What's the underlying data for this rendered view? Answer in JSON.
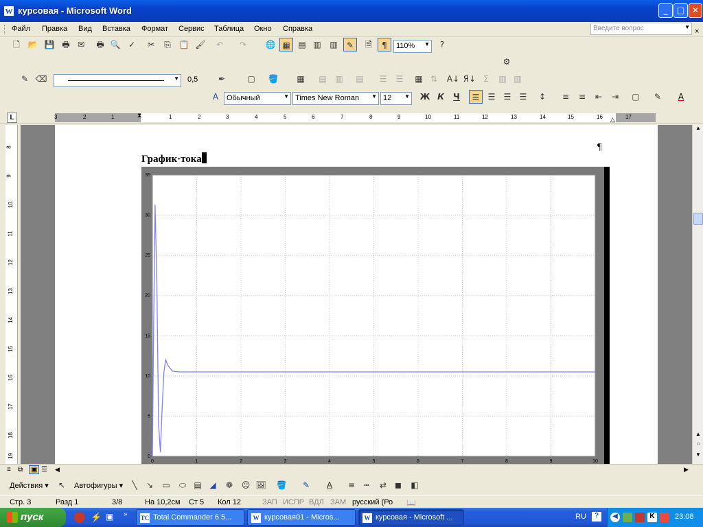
{
  "window": {
    "title": "курсовая - Microsoft Word",
    "app_icon": "word-icon"
  },
  "menu": {
    "items": [
      "Файл",
      "Правка",
      "Вид",
      "Вставка",
      "Формат",
      "Сервис",
      "Таблица",
      "Окно",
      "Справка"
    ],
    "ask_placeholder": "Введите вопрос"
  },
  "standard_toolbar": {
    "zoom": "110%"
  },
  "drawing_toolbar_top": {
    "line_width": "0,5"
  },
  "formatting_toolbar": {
    "style": "Обычный",
    "font": "Times New Roman",
    "size": "12"
  },
  "ruler": {
    "h_labels": [
      "3",
      "2",
      "1",
      "1",
      "2",
      "3",
      "4",
      "5",
      "6",
      "7",
      "8",
      "9",
      "10",
      "11",
      "12",
      "13",
      "14",
      "15",
      "16",
      "17"
    ],
    "v_labels": [
      "8",
      "9",
      "10",
      "11",
      "12",
      "13",
      "14",
      "15",
      "16",
      "17",
      "18",
      "19"
    ],
    "tab_button": "L"
  },
  "document": {
    "heading": "График·тока",
    "pilcrow": "¶"
  },
  "chart_data": {
    "type": "line",
    "title": "",
    "xlabel": "",
    "ylabel": "",
    "xlim": [
      0,
      10
    ],
    "ylim": [
      0,
      35
    ],
    "x_ticks": [
      "0",
      "1",
      "2",
      "3",
      "4",
      "5",
      "6",
      "7",
      "8",
      "9",
      "10"
    ],
    "y_ticks": [
      "0",
      "5",
      "10",
      "15",
      "20",
      "25",
      "30",
      "35"
    ],
    "grid": true,
    "line_color": "#7f7fff",
    "series": [
      {
        "name": "",
        "x": [
          0,
          0.03,
          0.06,
          0.1,
          0.14,
          0.18,
          0.22,
          0.26,
          0.3,
          0.35,
          0.45,
          0.6,
          1,
          2,
          3,
          4,
          5,
          6,
          7,
          8,
          9,
          10
        ],
        "y": [
          0,
          17,
          31.3,
          22,
          4,
          0.5,
          6,
          10.5,
          12,
          11.3,
          10.6,
          10.5,
          10.5,
          10.5,
          10.5,
          10.5,
          10.5,
          10.5,
          10.5,
          10.5,
          10.5,
          10.5
        ]
      }
    ]
  },
  "drawing_toolbar": {
    "actions": "Действия",
    "autoshapes": "Автофигуры"
  },
  "status": {
    "page": "Стр. 3",
    "section": "Разд 1",
    "pages": "3/8",
    "at": "На 10,2см",
    "line": "Ст 5",
    "col": "Кол 12",
    "rec": "ЗАП",
    "trk": "ИСПР",
    "ext": "ВДЛ",
    "ovr": "ЗАМ",
    "lang": "русский (Ро"
  },
  "taskbar": {
    "start": "пуск",
    "tasks": [
      "Total Commander 6.5...",
      "курсовая01 - Micros...",
      "курсовая - Microsoft ..."
    ],
    "lang": "RU",
    "clock": "23:08"
  }
}
